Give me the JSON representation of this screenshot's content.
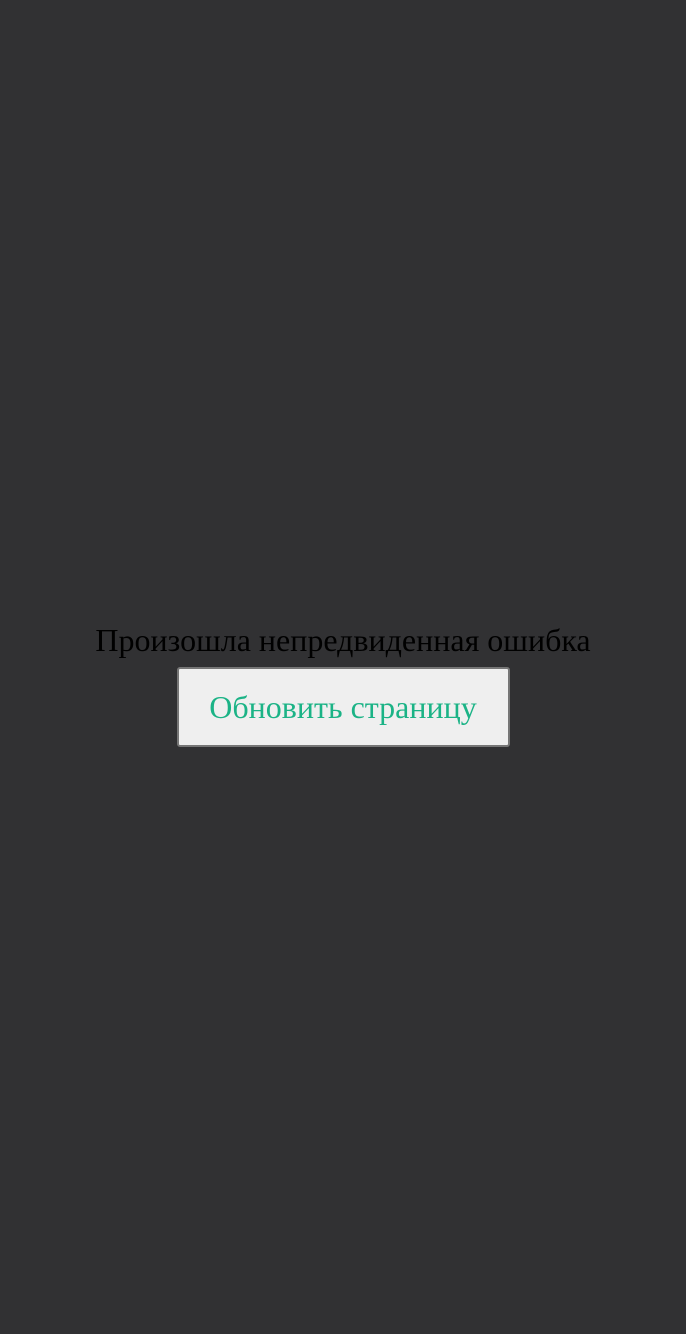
{
  "error": {
    "message": "Произошла непредвиденная ошибка",
    "reload_label": "Обновить страницу"
  },
  "colors": {
    "background": "#313133",
    "message_text": "#000000",
    "button_background": "#efefef",
    "button_border": "#767676",
    "button_text": "#1bb386"
  }
}
